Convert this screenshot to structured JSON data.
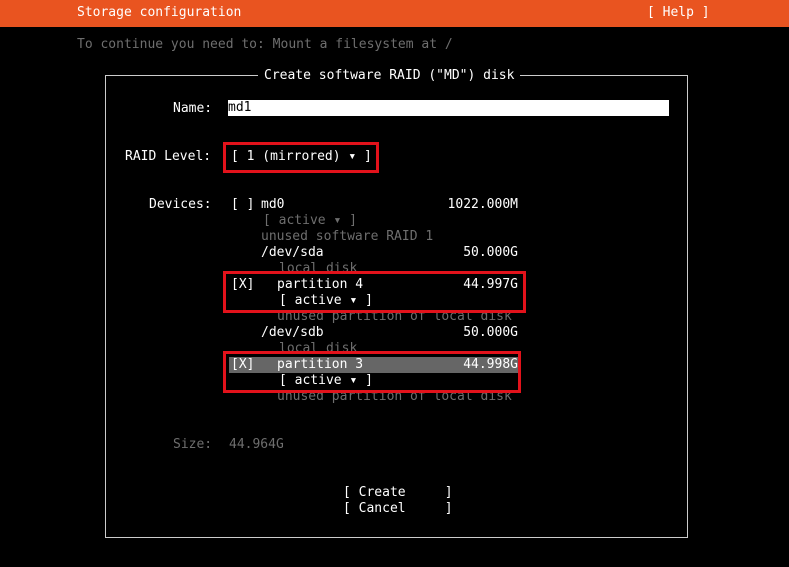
{
  "header": {
    "title": "Storage configuration",
    "help": "[ Help ]",
    "color": "#e95420"
  },
  "hint": "To continue you need to: Mount a filesystem at /",
  "dialog": {
    "title": "Create software RAID (\"MD\") disk",
    "name_label": "Name:",
    "name_value": "md1",
    "raid_label": "RAID Level:",
    "raid_value": "[ 1 (mirrored) ▾ ]",
    "devices_label": "Devices:",
    "devices": {
      "md0": {
        "checkbox": "[ ]",
        "name": "md0",
        "size": "1022.000M",
        "select": "[ active ▾ ]",
        "desc": "unused software RAID 1"
      },
      "sda": {
        "name": "/dev/sda",
        "size": "50.000G",
        "desc": "local disk"
      },
      "part4": {
        "checkbox": "[X]",
        "name": "partition 4",
        "size": "44.997G",
        "select": "[ active ▾ ]",
        "desc": "unused partition of local disk"
      },
      "sdb": {
        "name": "/dev/sdb",
        "size": "50.000G",
        "desc": "local disk"
      },
      "part3": {
        "checkbox": "[X]",
        "name": "partition 3",
        "size": "44.998G",
        "select": "[ active ▾ ]",
        "desc": "unused partition of local disk"
      }
    },
    "size_label": "Size:",
    "size_value": "44.964G",
    "create_label": "[ Create     ]",
    "cancel_label": "[ Cancel     ]"
  },
  "colors": {
    "accent": "#e95420",
    "highlight": "#e2121b",
    "dim": "#6e6e6e"
  }
}
